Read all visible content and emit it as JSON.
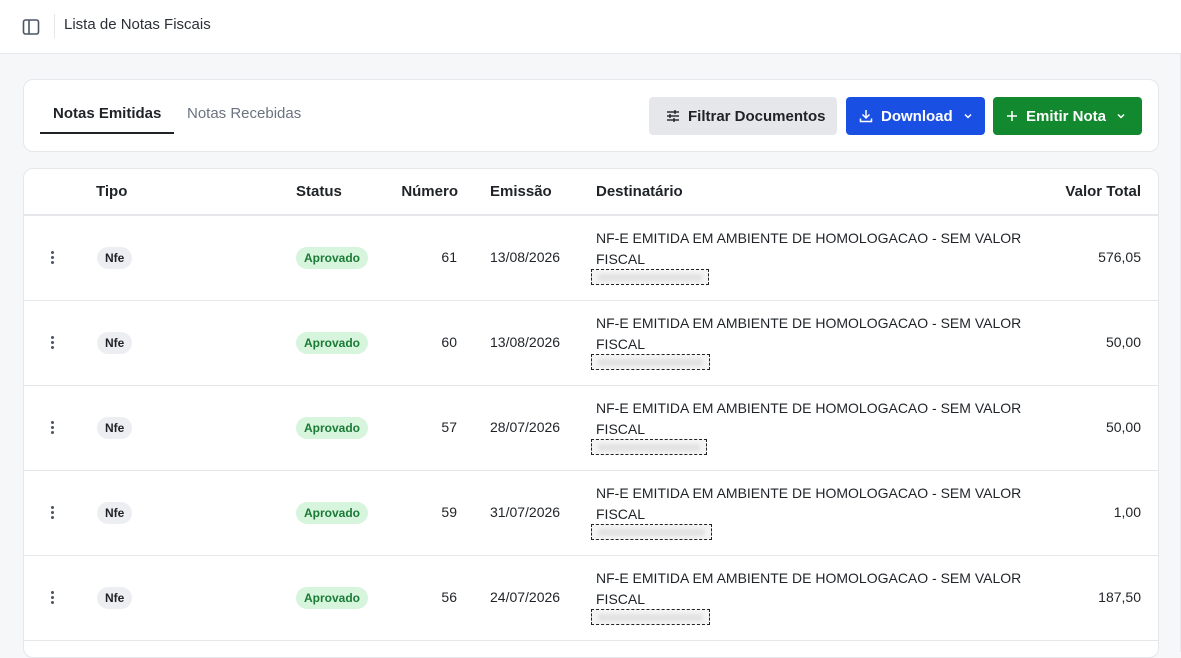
{
  "header": {
    "title": "Lista de Notas Fiscais",
    "sidebar_toggle_icon": "sidebar-panel-icon"
  },
  "tabs": [
    {
      "label": "Notas Emitidas",
      "active": true
    },
    {
      "label": "Notas Recebidas",
      "active": false
    }
  ],
  "actions": {
    "filter_label": "Filtrar Documentos",
    "download_label": "Download",
    "emitir_label": "Emitir Nota",
    "download_color": "#1a4fe3",
    "emitir_color": "#13892f"
  },
  "table": {
    "columns": {
      "tipo": "Tipo",
      "status": "Status",
      "numero": "Número",
      "emissao": "Emissão",
      "destinatario": "Destinatário",
      "valor": "Valor Total"
    },
    "rows": [
      {
        "tipo": "Nfe",
        "status": "Aprovado",
        "numero": "61",
        "emissao": "13/08/2026",
        "destinatario": "NF-E EMITIDA EM AMBIENTE DE HOMOLOGACAO - SEM VALOR FISCAL",
        "valor": "576,05"
      },
      {
        "tipo": "Nfe",
        "status": "Aprovado",
        "numero": "60",
        "emissao": "13/08/2026",
        "destinatario": "NF-E EMITIDA EM AMBIENTE DE HOMOLOGACAO - SEM VALOR FISCAL",
        "valor": "50,00"
      },
      {
        "tipo": "Nfe",
        "status": "Aprovado",
        "numero": "57",
        "emissao": "28/07/2026",
        "destinatario": "NF-E EMITIDA EM AMBIENTE DE HOMOLOGACAO - SEM VALOR FISCAL",
        "valor": "50,00"
      },
      {
        "tipo": "Nfe",
        "status": "Aprovado",
        "numero": "59",
        "emissao": "31/07/2026",
        "destinatario": "NF-E EMITIDA EM AMBIENTE DE HOMOLOGACAO - SEM VALOR FISCAL",
        "valor": "1,00"
      },
      {
        "tipo": "Nfe",
        "status": "Aprovado",
        "numero": "56",
        "emissao": "24/07/2026",
        "destinatario": "NF-E EMITIDA EM AMBIENTE DE HOMOLOGACAO - SEM VALOR FISCAL",
        "valor": "187,50"
      }
    ]
  }
}
